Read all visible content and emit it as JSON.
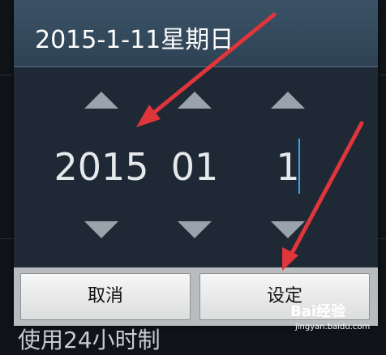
{
  "background": {
    "setting_label": "使用24小时制"
  },
  "dialog": {
    "title": "2015-1-11星期日",
    "picker": {
      "year": "2015",
      "month": "01",
      "day": "1"
    },
    "buttons": {
      "cancel": "取消",
      "set": "设定"
    }
  },
  "watermark": {
    "brand": "Bai经验",
    "url": "jingyan.baidu.com"
  },
  "colors": {
    "header": "#3b5266",
    "picker_bg": "#1e2935",
    "arrow": "#9aa3ab",
    "cursor": "#3ea0e8",
    "annotation": "#e0353b"
  },
  "icons": {
    "increment": "triangle-up-icon",
    "decrement": "triangle-down-icon",
    "annotation": "red-arrow"
  }
}
